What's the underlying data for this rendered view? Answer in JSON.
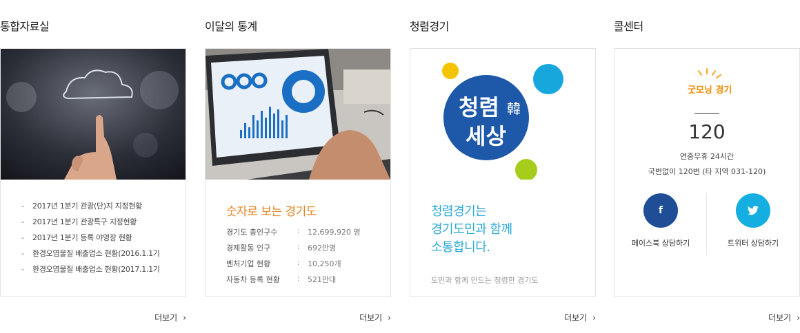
{
  "sections": {
    "archive": {
      "title": "통합자료실",
      "items": [
        "2017년 1분기 관광(단)지 지정현황",
        "2017년 1분기 관광특구 지정현황",
        "2017년 1분기 등록 야영장 현황",
        "환경오염물질 배출업소 현황(2016.1.1기",
        "환경오염물질 배출업소 현황(2017.1.1기"
      ],
      "more": "더보기"
    },
    "stats": {
      "title": "이달의 통계",
      "heading": "숫자로 보는 경기도",
      "rows": [
        {
          "label": "경기도 총인구수",
          "sep": ":",
          "value": "12,699,920 명"
        },
        {
          "label": "경제활동 인구",
          "sep": ":",
          "value": "692만명"
        },
        {
          "label": "벤처기업 현황",
          "sep": ":",
          "value": "10,250개"
        },
        {
          "label": "자동차 등록 현황",
          "sep": ":",
          "value": "521만대"
        }
      ],
      "more": "더보기"
    },
    "clean": {
      "title": "청렴경기",
      "logo_text": [
        "청렴",
        "세상"
      ],
      "logo_hanja": "韓",
      "slogan": [
        "청렴경기는",
        "경기도민과 함께",
        "소통합니다."
      ],
      "sub": "도민과 함께 만드는 청렴한 경기도",
      "more": "더보기"
    },
    "call": {
      "title": "콜센터",
      "logo_text": "굿모닝 경기",
      "number": "120",
      "hours": "연중무휴 24시간",
      "note": "국번없이 120번 (타 지역 031-120)",
      "facebook_label": "페이스북 상담하기",
      "twitter_label": "트위터 상담하기",
      "more": "더보기"
    }
  },
  "colors": {
    "accent_orange": "#e88423",
    "accent_blue": "#29a9d6",
    "facebook": "#1f4e96",
    "twitter": "#14aee0"
  },
  "icons": {
    "facebook": "facebook-icon",
    "twitter": "twitter-icon",
    "more": "chevron-right-icon"
  }
}
